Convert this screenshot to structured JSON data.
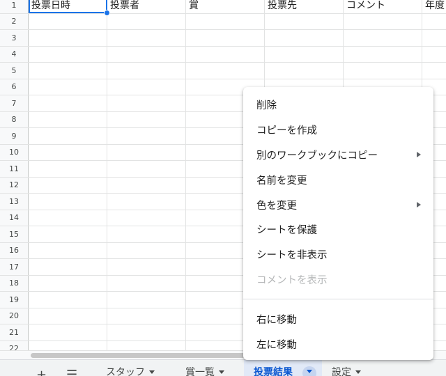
{
  "sheet": {
    "columns": [
      "投票日時",
      "投票者",
      "賞",
      "投票先",
      "コメント",
      "年度"
    ],
    "row_numbers": [
      "1",
      "2",
      "3",
      "4",
      "5",
      "6",
      "7",
      "8",
      "9",
      "10",
      "11",
      "12",
      "13",
      "14",
      "15",
      "16",
      "17",
      "18",
      "19",
      "20",
      "21",
      "22"
    ]
  },
  "tabbar": {
    "add_icon": "plus-icon",
    "all_sheets_icon": "hamburger-icon",
    "tabs": [
      {
        "label": "スタッフ"
      },
      {
        "label": "賞一覧"
      },
      {
        "label": "投票結果"
      },
      {
        "label": "設定"
      }
    ],
    "active_tab": "投票結果"
  },
  "context_menu": {
    "items": [
      {
        "label": "削除",
        "enabled": true
      },
      {
        "label": "コピーを作成",
        "enabled": true
      },
      {
        "label": "別のワークブックにコピー",
        "enabled": true,
        "submenu": true
      },
      {
        "label": "名前を変更",
        "enabled": true
      },
      {
        "label": "色を変更",
        "enabled": true,
        "submenu": true
      },
      {
        "label": "シートを保護",
        "enabled": true
      },
      {
        "label": "シートを非表示",
        "enabled": true
      },
      {
        "label": "コメントを表示",
        "enabled": false
      }
    ],
    "move_items": [
      {
        "label": "右に移動",
        "enabled": true
      },
      {
        "label": "左に移動",
        "enabled": true
      }
    ]
  },
  "colors": {
    "accent": "#1a73e8",
    "active_tab_bg": "#e1e9f7",
    "active_tab_text": "#0b57d0"
  }
}
